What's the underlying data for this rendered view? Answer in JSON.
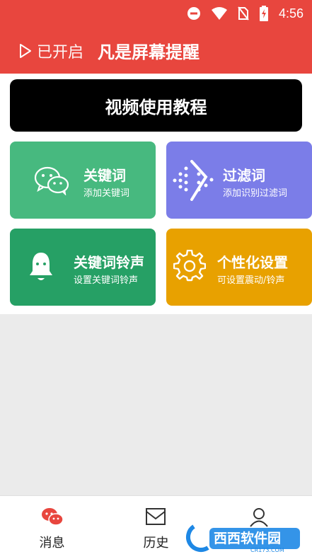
{
  "status_bar": {
    "time": "4:56"
  },
  "header": {
    "toggle_label": "已开启",
    "app_title": "凡是屏幕提醒"
  },
  "video_tutorial_button": "视频使用教程",
  "cards": [
    {
      "title": "关键词",
      "subtitle": "添加关键词",
      "color": "#47b97f"
    },
    {
      "title": "过滤词",
      "subtitle": "添加识别过滤词",
      "color": "#7b7de8"
    },
    {
      "title": "关键词铃声",
      "subtitle": "设置关键词铃声",
      "color": "#26a065"
    },
    {
      "title": "个性化设置",
      "subtitle": "可设置震动/铃声",
      "color": "#e8a100"
    }
  ],
  "bottom_nav": [
    {
      "label": "消息",
      "active": true
    },
    {
      "label": "历史",
      "active": false
    },
    {
      "label": "我的",
      "active": false
    }
  ],
  "watermark": {
    "text": "西西软件园",
    "domain": "CR173.COM"
  },
  "colors": {
    "header": "#e8463e",
    "gray_area": "#ebebeb"
  }
}
